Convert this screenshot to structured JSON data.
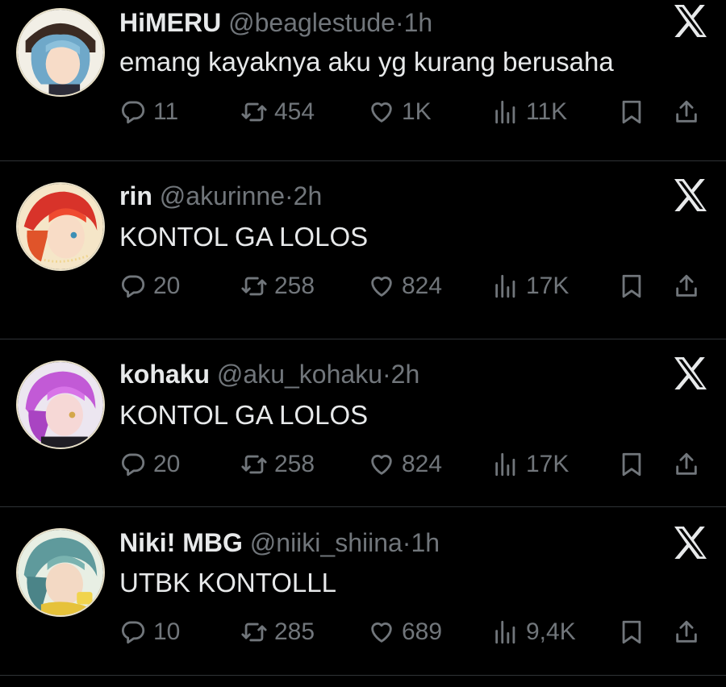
{
  "tweets": [
    {
      "name": "HiMERU",
      "handle": "@beaglestude",
      "dot": "·",
      "time": "1h",
      "text": "emang kayaknya aku yg kurang berusaha",
      "replies": "11",
      "retweets": "454",
      "likes": "1K",
      "views": "11K",
      "avatar_color": "#6fa8c9"
    },
    {
      "name": "rin",
      "handle": "@akurinne",
      "dot": "·",
      "time": "2h",
      "text": "KONTOL GA LOLOS",
      "replies": "20",
      "retweets": "258",
      "likes": "824",
      "views": "17K",
      "avatar_color": "#d8332a"
    },
    {
      "name": "kohaku",
      "handle": "@aku_kohaku",
      "dot": "·",
      "time": "2h",
      "text": "KONTOL GA LOLOS",
      "replies": "20",
      "retweets": "258",
      "likes": "824",
      "views": "17K",
      "avatar_color": "#c25ad6"
    },
    {
      "name": "Niki! MBG",
      "handle": "@niiki_shiina",
      "dot": "·",
      "time": "1h",
      "text": "UTBK KONTOLLL",
      "replies": "10",
      "retweets": "285",
      "likes": "689",
      "views": "9,4K",
      "avatar_color": "#5f9a9c"
    }
  ],
  "icons": {
    "reply": "reply-icon",
    "retweet": "retweet-icon",
    "like": "heart-icon",
    "views": "views-icon",
    "bookmark": "bookmark-icon",
    "share": "share-icon",
    "logo": "x-logo-icon"
  },
  "colors": {
    "background": "#000000",
    "text": "#e7e9ea",
    "muted": "#71767b",
    "divider": "#2f3336"
  }
}
